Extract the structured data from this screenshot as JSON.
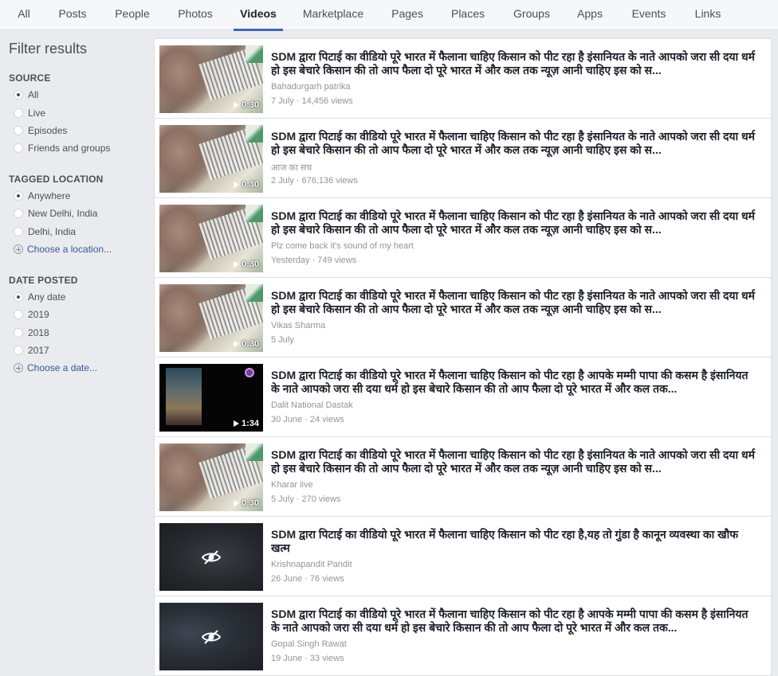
{
  "tabs": [
    "All",
    "Posts",
    "People",
    "Photos",
    "Videos",
    "Marketplace",
    "Pages",
    "Places",
    "Groups",
    "Apps",
    "Events",
    "Links"
  ],
  "active_tab": "Videos",
  "sidebar": {
    "title": "Filter results",
    "source": {
      "heading": "SOURCE",
      "options": [
        "All",
        "Live",
        "Episodes",
        "Friends and groups"
      ],
      "selected": "All"
    },
    "location": {
      "heading": "TAGGED LOCATION",
      "options": [
        "Anywhere",
        "New Delhi, India",
        "Delhi, India"
      ],
      "selected": "Anywhere",
      "choose": "Choose a location..."
    },
    "date": {
      "heading": "DATE POSTED",
      "options": [
        "Any date",
        "2019",
        "2018",
        "2017"
      ],
      "selected": "Any date",
      "choose": "Choose a date..."
    }
  },
  "results": [
    {
      "title": "SDM द्वारा पिटाई का वीडियो पूरे भारत में फैलाना चाहिए किसान को पीट रहा है इंसानियत के नाते आपको जरा सी दया धर्म हो इस बेचारे किसान की तो आप फैला दो पूरे भारत में और कल तक न्यूज़ आनी चाहिए इस को स...",
      "source": "Bahadurgarh patrika",
      "meta": "7 July · 14,456 views",
      "duration": "0:30",
      "thumb": "a"
    },
    {
      "title": "SDM द्वारा पिटाई का वीडियो पूरे भारत में फैलाना चाहिए किसान को पीट रहा है इंसानियत के नाते आपको जरा सी दया धर्म हो इस बेचारे किसान की तो आप फैला दो पूरे भारत में और कल तक न्यूज़ आनी चाहिए इस को स...",
      "source": "आज का सच",
      "meta": "2 July · 676,136 views",
      "duration": "0:30",
      "thumb": "a"
    },
    {
      "title": "SDM द्वारा पिटाई का वीडियो पूरे भारत में फैलाना चाहिए किसान को पीट रहा है इंसानियत के नाते आपको जरा सी दया धर्म हो इस बेचारे किसान की तो आप फैला दो पूरे भारत में और कल तक न्यूज़ आनी चाहिए इस को स...",
      "source": "Plz come back it's sound of my heart",
      "meta": "Yesterday · 749 views",
      "duration": "0:30",
      "thumb": "a"
    },
    {
      "title": "SDM द्वारा पिटाई का वीडियो पूरे भारत में फैलाना चाहिए किसान को पीट रहा है इंसानियत के नाते आपको जरा सी दया धर्म हो इस बेचारे किसान की तो आप फैला दो पूरे भारत में और कल तक न्यूज़ आनी चाहिए इस को स...",
      "source": "Vikas Sharma",
      "meta": "5 July",
      "duration": "0:30",
      "thumb": "a"
    },
    {
      "title": "SDM द्वारा पिटाई का वीडियो पूरे भारत में फैलाना चाहिए किसान को पीट रहा है आपके मम्मी पापा की कसम है इंसानियत के नाते आपको जरा सी दया धर्म हो इस बेचारे किसान की तो आप फैला दो पूरे भारत में और कल तक...",
      "source": "Dalit National Dastak",
      "meta": "30 June · 24 views",
      "duration": "1:34",
      "thumb": "b"
    },
    {
      "title": "SDM द्वारा पिटाई का वीडियो पूरे भारत में फैलाना चाहिए किसान को पीट रहा है इंसानियत के नाते आपको जरा सी दया धर्म हो इस बेचारे किसान की तो आप फैला दो पूरे भारत में और कल तक न्यूज़ आनी चाहिए इस को स...",
      "source": "Kharar live",
      "meta": "5 July · 270 views",
      "duration": "0:30",
      "thumb": "a"
    },
    {
      "title": "SDM द्वारा पिटाई का वीडियो पूरे भारत में फैलाना चाहिए किसान को पीट रहा है,यह तो गुंडा है कानून व्यवस्था का खौफ खत्म",
      "source": "Krishnapandit Pandit",
      "meta": "26 June · 76 views",
      "duration": "",
      "thumb": "c"
    },
    {
      "title": "SDM द्वारा पिटाई का वीडियो पूरे भारत में फैलाना चाहिए किसान को पीट रहा है आपके मम्मी पापा की कसम है इंसानियत के नाते आपको जरा सी दया धर्म हो इस बेचारे किसान की तो आप फैला दो पूरे भारत में और कल तक...",
      "source": "Gopal Singh Rawat",
      "meta": "19 June · 33 views",
      "duration": "",
      "thumb": "d"
    }
  ]
}
